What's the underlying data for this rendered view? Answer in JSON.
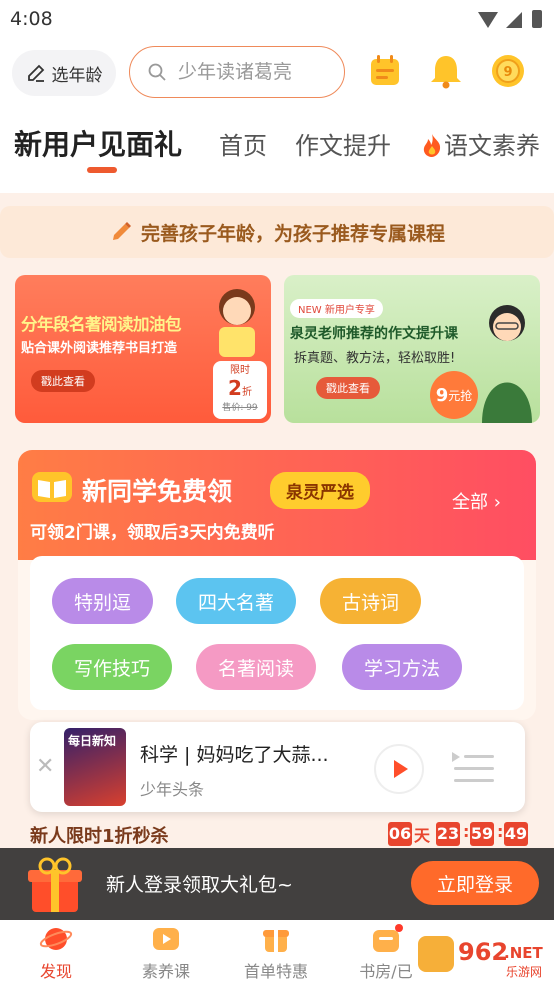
{
  "status_bar": {
    "time": "4:08"
  },
  "header": {
    "age_button": "选年龄",
    "search_placeholder": "少年读诸葛亮",
    "icons": [
      "calendar-icon",
      "bell-icon",
      "coin-icon"
    ]
  },
  "tabs": [
    {
      "label": "新用户见面礼",
      "active": true
    },
    {
      "label": "首页",
      "active": false
    },
    {
      "label": "作文提升",
      "active": false
    },
    {
      "label": "语文素养",
      "active": false,
      "icon": "fire-icon"
    }
  ],
  "notice": "完善孩子年龄，为孩子推荐专属课程",
  "banners": [
    {
      "title": "分年段名著阅读加油包",
      "subtitle": "贴合课外阅读推荐书目打造",
      "cta": "戳此查看",
      "badge_top": "限时",
      "badge_value": "2",
      "badge_unit": "折",
      "original_price": "售价: 99"
    },
    {
      "tag": "NEW 新用户专享",
      "title": "泉灵老师推荐的作文提升课",
      "subtitle": "拆真题、教方法，轻松取胜!",
      "cta": "戳此查看",
      "price_value": "9",
      "price_unit": "元抢"
    }
  ],
  "free_section": {
    "title": "新同学免费领",
    "brand_tag": "泉灵严选",
    "subtitle": "可领2门课，领取后3天内免费听",
    "all_link": "全部 ›",
    "chips": [
      {
        "label": "特别逗",
        "color": "#b98be8"
      },
      {
        "label": "四大名著",
        "color": "#5cc4f0"
      },
      {
        "label": "古诗词",
        "color": "#f6b234"
      },
      {
        "label": "写作技巧",
        "color": "#7ad462"
      },
      {
        "label": "名著阅读",
        "color": "#f59ac4"
      },
      {
        "label": "学习方法",
        "color": "#b98be8"
      }
    ]
  },
  "player": {
    "cover_label": "每日新知",
    "title": "科学 | 妈妈吃了大蒜...",
    "source": "少年头条"
  },
  "flash_sale": {
    "title": "新人限时1折秒杀",
    "days": "06",
    "day_unit": "天",
    "hours": "23",
    "minutes": "59",
    "seconds": "49"
  },
  "login_bar": {
    "text": "新人登录领取大礼包~",
    "button": "立即登录"
  },
  "bottom_nav": [
    {
      "label": "发现",
      "active": true,
      "icon": "planet-icon"
    },
    {
      "label": "素养课",
      "active": false,
      "icon": "tv-icon"
    },
    {
      "label": "首单特惠",
      "active": false,
      "icon": "gift-box-icon"
    },
    {
      "label": "书房/已",
      "active": false,
      "icon": "bookshelf-icon"
    }
  ],
  "watermark": {
    "number": "962",
    "suffix": ".NET",
    "caption": "乐游网"
  },
  "colors": {
    "accent": "#ee5a2f",
    "login_button": "#ff6a2a",
    "timer": "#e8452e"
  }
}
